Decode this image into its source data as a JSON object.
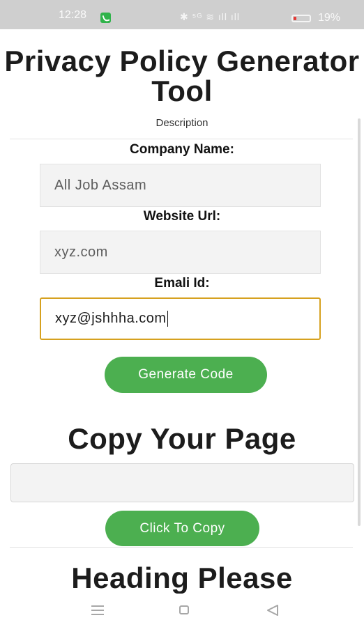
{
  "status_bar": {
    "time": "12:28",
    "icons_text": "✱ ⁵ᴳ ≋ ıll ıll",
    "battery_percent": "19%",
    "battery_level": 0.19,
    "battery_color": "#e53935"
  },
  "page": {
    "title": "Privacy Policy Generator Tool",
    "description": "Description"
  },
  "form": {
    "company_label": "Company Name:",
    "company_value": "All Job Assam",
    "website_label": "Website Url:",
    "website_value": "xyz.com",
    "email_label": "Emali Id:",
    "email_value": "xyz@jshhha.com",
    "generate_button": "Generate Code"
  },
  "copy_section": {
    "heading": "Copy Your Page",
    "output_value": "",
    "copy_button": "Click To Copy"
  },
  "next_section": {
    "heading": "Heading Please"
  },
  "nav_bar": {
    "icons": [
      "menu-icon",
      "home-icon",
      "back-icon"
    ]
  },
  "colors": {
    "accent_green": "#4caf50",
    "focus_border": "#d6a11f",
    "status_bar_bg": "#cfcfcf"
  }
}
